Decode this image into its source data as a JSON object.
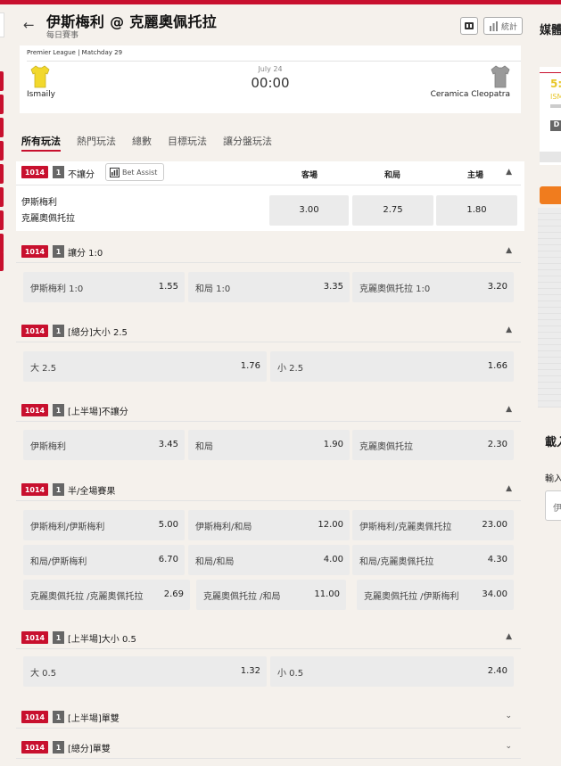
{
  "header": {
    "title": "伊斯梅利 @ 克麗奧佩托拉",
    "subtitle": "每日賽事",
    "back_icon": "←",
    "stats_label": "統計"
  },
  "match": {
    "league": "Premier League | Matchday 29",
    "date": "July 24",
    "time": "00:00",
    "home": "Ismaily",
    "away": "Ceramica Cleopatra",
    "home_color": "#f2d82c",
    "away_color": "#9a9a9a"
  },
  "tabs": [
    "所有玩法",
    "熱門玩法",
    "總數",
    "目標玩法",
    "讓分盤玩法"
  ],
  "market1": {
    "id": "1014",
    "num": "1",
    "name": "不讓分",
    "assist": "Bet Assist",
    "col1": "客場",
    "col2": "和局",
    "col3": "主場",
    "team1": "伊斯梅利",
    "team2": "克麗奧佩托拉",
    "odds": [
      "3.00",
      "2.75",
      "1.80"
    ]
  },
  "markets": [
    {
      "id": "1014",
      "num": "1",
      "name": "讓分 1:0",
      "rows": [
        [
          {
            "l": "伊斯梅利 1:0",
            "o": "1.55"
          },
          {
            "l": "和局 1:0",
            "o": "3.35"
          },
          {
            "l": "克麗奧佩托拉 1:0",
            "o": "3.20"
          }
        ]
      ]
    },
    {
      "id": "1014",
      "num": "1",
      "name": "[總分]大小 2.5",
      "rows": [
        [
          {
            "l": "大 2.5",
            "o": "1.76"
          },
          {
            "l": "小 2.5",
            "o": "1.66"
          }
        ]
      ]
    },
    {
      "id": "1014",
      "num": "1",
      "name": "[上半場]不讓分",
      "rows": [
        [
          {
            "l": "伊斯梅利",
            "o": "3.45"
          },
          {
            "l": "和局",
            "o": "1.90"
          },
          {
            "l": "克麗奧佩托拉",
            "o": "2.30"
          }
        ]
      ]
    },
    {
      "id": "1014",
      "num": "1",
      "name": "半/全場賽果",
      "rows": [
        [
          {
            "l": "伊斯梅利/伊斯梅利",
            "o": "5.00"
          },
          {
            "l": "伊斯梅利/和局",
            "o": "12.00"
          },
          {
            "l": "伊斯梅利/克麗奧佩托拉",
            "o": "23.00"
          }
        ],
        [
          {
            "l": "和局/伊斯梅利",
            "o": "6.70"
          },
          {
            "l": "和局/和局",
            "o": "4.00"
          },
          {
            "l": "和局/克麗奧佩托拉",
            "o": "4.30"
          }
        ],
        [
          {
            "l": "克麗奧佩托拉 /克麗奧佩托拉",
            "o": "2.69"
          },
          {
            "l": "克麗奧佩托拉 /和局",
            "o": "11.00"
          },
          {
            "l": "克麗奧佩托拉 /伊斯梅利",
            "o": "34.00"
          }
        ]
      ]
    },
    {
      "id": "1014",
      "num": "1",
      "name": "[上半場]大小 0.5",
      "rows": [
        [
          {
            "l": "大 0.5",
            "o": "1.32"
          },
          {
            "l": "小 0.5",
            "o": "2.40"
          }
        ]
      ]
    },
    {
      "id": "1014",
      "num": "1",
      "name": "[上半場]單雙",
      "rows": []
    },
    {
      "id": "1014",
      "num": "1",
      "name": "[總分]單雙",
      "rows": []
    }
  ],
  "right": {
    "label1": "媒體",
    "num": "5:",
    "sub": "ISM",
    "d": "D",
    "label2": "載入",
    "label3": "輸入",
    "label4": "伊"
  }
}
